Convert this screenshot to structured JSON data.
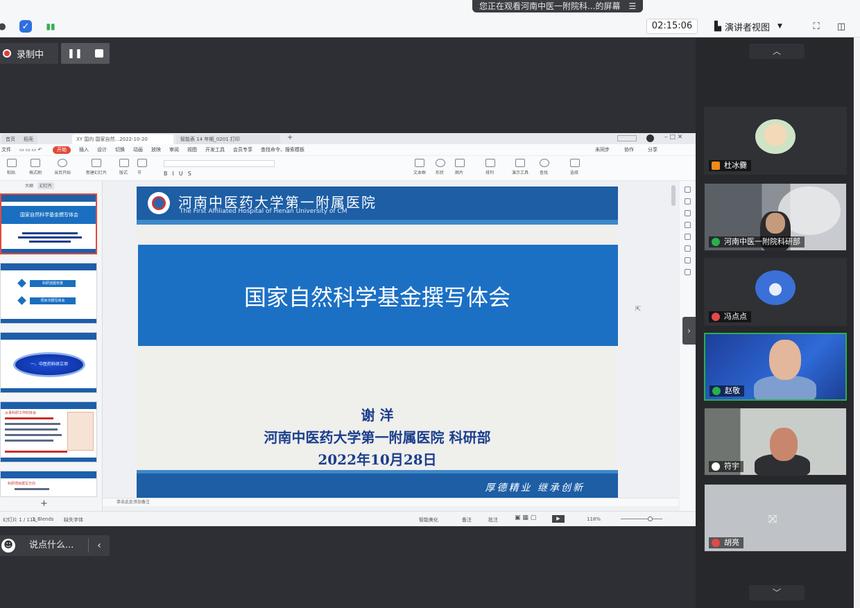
{
  "top_bar": {
    "share_banner": "您正在观看河南中医一附院科...的屏幕",
    "banner_menu_icon": "menu-lines-icon",
    "timer": "02:15:06",
    "view_mode": "演讲者视图"
  },
  "recording": {
    "label": "录制中"
  },
  "chat": {
    "placeholder": "说点什么..."
  },
  "wps": {
    "tabs": [
      "首页",
      "稻壳",
      "XY 国内 国家自然...2022-10-20",
      "智能表 14 年期_0201 打印"
    ],
    "menu": [
      "文件",
      "开始",
      "插入",
      "设计",
      "切换",
      "动画",
      "放映",
      "审阅",
      "视图",
      "开发工具",
      "会员专享",
      "查找命令、搜索模板"
    ],
    "menu_right": [
      "未同步",
      "协作",
      "分享"
    ],
    "ribbon": [
      "粘贴",
      "格式刷",
      "当页开始",
      "新建幻灯片",
      "版式",
      "节",
      "重置",
      "文本框",
      "形状",
      "图片",
      "排列",
      "演示工具",
      "查找",
      "替换",
      "选择"
    ],
    "panel_tabs": [
      "大纲",
      "幻灯片"
    ],
    "thumbs": [
      {
        "title": "国家自然科学基金撰写体会"
      },
      {
        "items": [
          "科研选题背景",
          "项目书撰写体会"
        ]
      },
      {
        "title": "一、中医药科研立项"
      },
      {
        "caption": "从事科研工作的体会"
      },
      {
        "caption": "科研项目撰写方向"
      }
    ],
    "notes": "单击此处添加备注",
    "status": {
      "page": "幻灯片 1 / 115",
      "theme": "1_Blends",
      "font_missing": "缺失字体",
      "smart": "智能美化",
      "notes_btn": "备注",
      "comment_btn": "批注",
      "zoom": "118%"
    }
  },
  "slide": {
    "institution_cn": "河南中医药大学第一附属医院",
    "institution_en": "The First Affiliated Hospital of Henan University of CM",
    "title": "国家自然科学基金撰写体会",
    "speaker": "谢 洋",
    "affiliation": "河南中医药大学第一附属医院  科研部",
    "date": "2022年10月28日",
    "motto": "厚德精业  继承创新"
  },
  "participants": [
    {
      "name": "杜冰爨",
      "mic": "presenter"
    },
    {
      "name": "河南中医一附院科研部",
      "mic": "on"
    },
    {
      "name": "冯点点",
      "mic": "muted"
    },
    {
      "name": "赵敬",
      "mic": "speaking"
    },
    {
      "name": "符宇",
      "mic": "on"
    },
    {
      "name": "胡亮",
      "mic": "muted",
      "camera": "off"
    }
  ],
  "colors": {
    "slide_blue": "#1d5ea5",
    "band_blue": "#1c70c4",
    "speaker_text": "#1b3e8c",
    "active_green": "#27b14c",
    "record_red": "#e53935"
  }
}
